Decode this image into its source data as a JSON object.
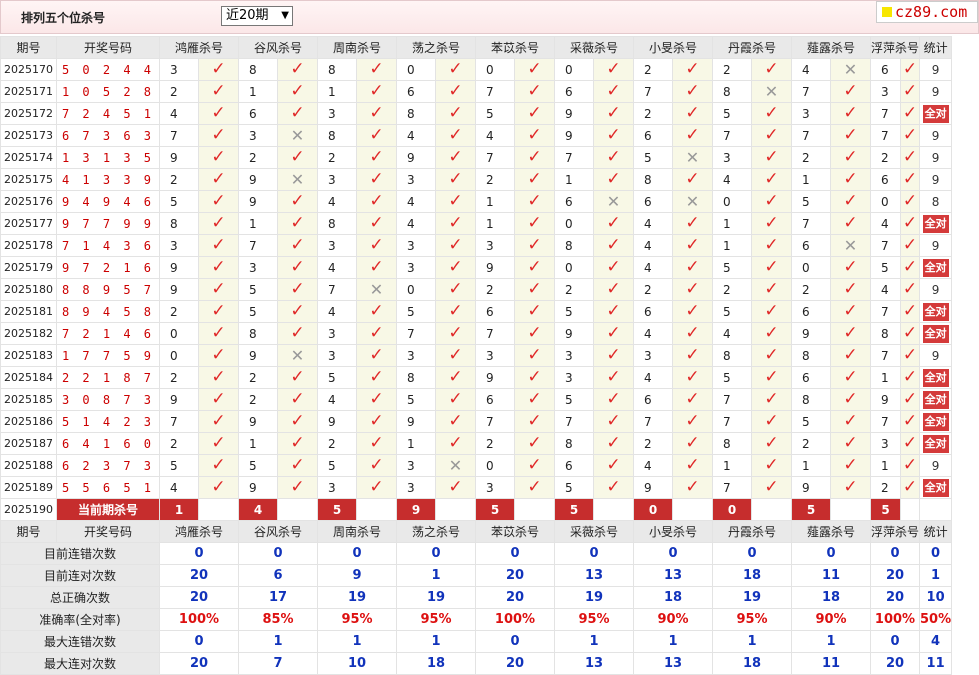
{
  "header": {
    "title": "排列五个位杀号",
    "period_select": "近20期",
    "brand": "cz89.com"
  },
  "columns": [
    "期号",
    "开奖号码",
    "鸿雁杀号",
    "谷风杀号",
    "周南杀号",
    "荡之杀号",
    "苯苡杀号",
    "采薇杀号",
    "小旻杀号",
    "丹霞杀号",
    "薤露杀号",
    "浮萍杀号",
    "统计"
  ],
  "rows": [
    {
      "p": "2025170",
      "c": "50244",
      "k": [
        "3",
        "8",
        "8",
        "0",
        "0",
        "0",
        "2",
        "2",
        "4",
        "6"
      ],
      "m": [
        1,
        1,
        1,
        1,
        1,
        1,
        1,
        1,
        0,
        1
      ],
      "s": "9"
    },
    {
      "p": "2025171",
      "c": "10528",
      "k": [
        "2",
        "1",
        "1",
        "6",
        "7",
        "6",
        "7",
        "8",
        "7",
        "3"
      ],
      "m": [
        1,
        1,
        1,
        1,
        1,
        1,
        1,
        0,
        1,
        1
      ],
      "s": "9"
    },
    {
      "p": "2025172",
      "c": "72451",
      "k": [
        "4",
        "6",
        "3",
        "8",
        "5",
        "9",
        "2",
        "5",
        "3",
        "7"
      ],
      "m": [
        1,
        1,
        1,
        1,
        1,
        1,
        1,
        1,
        1,
        1
      ],
      "s": "全对"
    },
    {
      "p": "2025173",
      "c": "67363",
      "k": [
        "7",
        "3",
        "8",
        "4",
        "4",
        "9",
        "6",
        "7",
        "7",
        "7"
      ],
      "m": [
        1,
        0,
        1,
        1,
        1,
        1,
        1,
        1,
        1,
        1
      ],
      "s": "9"
    },
    {
      "p": "2025174",
      "c": "13135",
      "k": [
        "9",
        "2",
        "2",
        "9",
        "7",
        "7",
        "5",
        "3",
        "2",
        "2"
      ],
      "m": [
        1,
        1,
        1,
        1,
        1,
        1,
        0,
        1,
        1,
        1
      ],
      "s": "9"
    },
    {
      "p": "2025175",
      "c": "41339",
      "k": [
        "2",
        "9",
        "3",
        "3",
        "2",
        "1",
        "8",
        "4",
        "1",
        "6"
      ],
      "m": [
        1,
        0,
        1,
        1,
        1,
        1,
        1,
        1,
        1,
        1
      ],
      "s": "9"
    },
    {
      "p": "2025176",
      "c": "94946",
      "k": [
        "5",
        "9",
        "4",
        "4",
        "1",
        "6",
        "6",
        "0",
        "5",
        "0"
      ],
      "m": [
        1,
        1,
        1,
        1,
        1,
        0,
        0,
        1,
        1,
        1
      ],
      "s": "8"
    },
    {
      "p": "2025177",
      "c": "97799",
      "k": [
        "8",
        "1",
        "8",
        "4",
        "1",
        "0",
        "4",
        "1",
        "7",
        "4"
      ],
      "m": [
        1,
        1,
        1,
        1,
        1,
        1,
        1,
        1,
        1,
        1
      ],
      "s": "全对"
    },
    {
      "p": "2025178",
      "c": "71436",
      "k": [
        "3",
        "7",
        "3",
        "3",
        "3",
        "8",
        "4",
        "1",
        "6",
        "7"
      ],
      "m": [
        1,
        1,
        1,
        1,
        1,
        1,
        1,
        1,
        0,
        1
      ],
      "s": "9"
    },
    {
      "p": "2025179",
      "c": "97216",
      "k": [
        "9",
        "3",
        "4",
        "3",
        "9",
        "0",
        "4",
        "5",
        "0",
        "5"
      ],
      "m": [
        1,
        1,
        1,
        1,
        1,
        1,
        1,
        1,
        1,
        1
      ],
      "s": "全对"
    },
    {
      "p": "2025180",
      "c": "88957",
      "k": [
        "9",
        "5",
        "7",
        "0",
        "2",
        "2",
        "2",
        "2",
        "2",
        "4"
      ],
      "m": [
        1,
        1,
        0,
        1,
        1,
        1,
        1,
        1,
        1,
        1
      ],
      "s": "9"
    },
    {
      "p": "2025181",
      "c": "89458",
      "k": [
        "2",
        "5",
        "4",
        "5",
        "6",
        "5",
        "6",
        "5",
        "6",
        "7"
      ],
      "m": [
        1,
        1,
        1,
        1,
        1,
        1,
        1,
        1,
        1,
        1
      ],
      "s": "全对"
    },
    {
      "p": "2025182",
      "c": "72146",
      "k": [
        "0",
        "8",
        "3",
        "7",
        "7",
        "9",
        "4",
        "4",
        "9",
        "8"
      ],
      "m": [
        1,
        1,
        1,
        1,
        1,
        1,
        1,
        1,
        1,
        1
      ],
      "s": "全对"
    },
    {
      "p": "2025183",
      "c": "17759",
      "k": [
        "0",
        "9",
        "3",
        "3",
        "3",
        "3",
        "3",
        "8",
        "8",
        "7"
      ],
      "m": [
        1,
        0,
        1,
        1,
        1,
        1,
        1,
        1,
        1,
        1
      ],
      "s": "9"
    },
    {
      "p": "2025184",
      "c": "22187",
      "k": [
        "2",
        "2",
        "5",
        "8",
        "9",
        "3",
        "4",
        "5",
        "6",
        "1"
      ],
      "m": [
        1,
        1,
        1,
        1,
        1,
        1,
        1,
        1,
        1,
        1
      ],
      "s": "全对"
    },
    {
      "p": "2025185",
      "c": "30873",
      "k": [
        "9",
        "2",
        "4",
        "5",
        "6",
        "5",
        "6",
        "7",
        "8",
        "9"
      ],
      "m": [
        1,
        1,
        1,
        1,
        1,
        1,
        1,
        1,
        1,
        1
      ],
      "s": "全对"
    },
    {
      "p": "2025186",
      "c": "51423",
      "k": [
        "7",
        "9",
        "9",
        "9",
        "7",
        "7",
        "7",
        "7",
        "5",
        "7"
      ],
      "m": [
        1,
        1,
        1,
        1,
        1,
        1,
        1,
        1,
        1,
        1
      ],
      "s": "全对"
    },
    {
      "p": "2025187",
      "c": "64160",
      "k": [
        "2",
        "1",
        "2",
        "1",
        "2",
        "8",
        "2",
        "8",
        "2",
        "3"
      ],
      "m": [
        1,
        1,
        1,
        1,
        1,
        1,
        1,
        1,
        1,
        1
      ],
      "s": "全对"
    },
    {
      "p": "2025188",
      "c": "62373",
      "k": [
        "5",
        "5",
        "5",
        "3",
        "0",
        "6",
        "4",
        "1",
        "1",
        "1"
      ],
      "m": [
        1,
        1,
        1,
        0,
        1,
        1,
        1,
        1,
        1,
        1
      ],
      "s": "9"
    },
    {
      "p": "2025189",
      "c": "55651",
      "k": [
        "4",
        "9",
        "3",
        "3",
        "3",
        "5",
        "9",
        "7",
        "9",
        "2"
      ],
      "m": [
        1,
        1,
        1,
        1,
        1,
        1,
        1,
        1,
        1,
        1
      ],
      "s": "全对"
    }
  ],
  "current": {
    "p": "2025190",
    "label": "当前期杀号",
    "k": [
      "1",
      "4",
      "5",
      "9",
      "5",
      "5",
      "0",
      "0",
      "5",
      "5"
    ]
  },
  "summary": [
    {
      "label": "目前连错次数",
      "v": [
        "0",
        "0",
        "0",
        "0",
        "0",
        "0",
        "0",
        "0",
        "0",
        "0"
      ],
      "s": "0"
    },
    {
      "label": "目前连对次数",
      "v": [
        "20",
        "6",
        "9",
        "1",
        "20",
        "13",
        "13",
        "18",
        "11",
        "20"
      ],
      "s": "1"
    },
    {
      "label": "总正确次数",
      "v": [
        "20",
        "17",
        "19",
        "19",
        "20",
        "19",
        "18",
        "19",
        "18",
        "20"
      ],
      "s": "10"
    },
    {
      "label": "准确率(全对率)",
      "v": [
        "100%",
        "85%",
        "95%",
        "95%",
        "100%",
        "95%",
        "90%",
        "95%",
        "90%",
        "100%"
      ],
      "s": "50%",
      "pct": true
    },
    {
      "label": "最大连错次数",
      "v": [
        "0",
        "1",
        "1",
        "1",
        "0",
        "1",
        "1",
        "1",
        "1",
        "0"
      ],
      "s": "4"
    },
    {
      "label": "最大连对次数",
      "v": [
        "20",
        "7",
        "10",
        "18",
        "20",
        "13",
        "13",
        "18",
        "11",
        "20"
      ],
      "s": "11"
    }
  ],
  "icons": {
    "hit": "check-icon",
    "miss": "cross-icon"
  },
  "colors": {
    "accent": "#c62d2d",
    "number": "#cc0000",
    "hit": "#e02828",
    "summary": "#1133bb"
  }
}
